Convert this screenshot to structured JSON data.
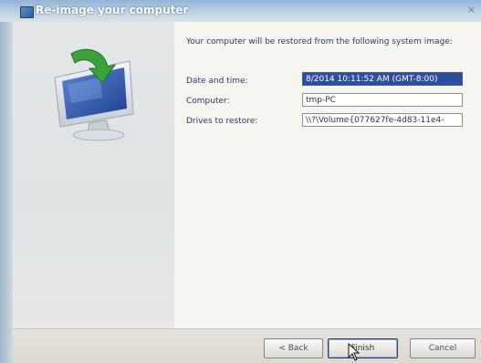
{
  "window": {
    "title": "Re-image your computer",
    "close_glyph": "×",
    "icon": "system-restore-window-icon"
  },
  "side_panel": {
    "icon": "restore-computer-monitor-icon"
  },
  "content": {
    "intro": "Your computer will be restored from the following system image:",
    "fields": [
      {
        "label": "Date and time:",
        "value": "8/2014 10:11:52 AM (GMT-8:00)",
        "selected": true
      },
      {
        "label": "Computer:",
        "value": "tmp-PC",
        "selected": false
      },
      {
        "label": "Drives to restore:",
        "value": "\\\\?\\Volume{077627fe-4d83-11e4-",
        "selected": false
      }
    ]
  },
  "footer": {
    "back_label": "< Back",
    "finish_label": "Finish",
    "cancel_label": "Cancel"
  },
  "colors": {
    "titlebar_blue": "#8fb3d6",
    "text_navy": "#2c3a6a",
    "selection_blue": "#2c4ea0",
    "panel_gray": "#e4e6e8"
  }
}
